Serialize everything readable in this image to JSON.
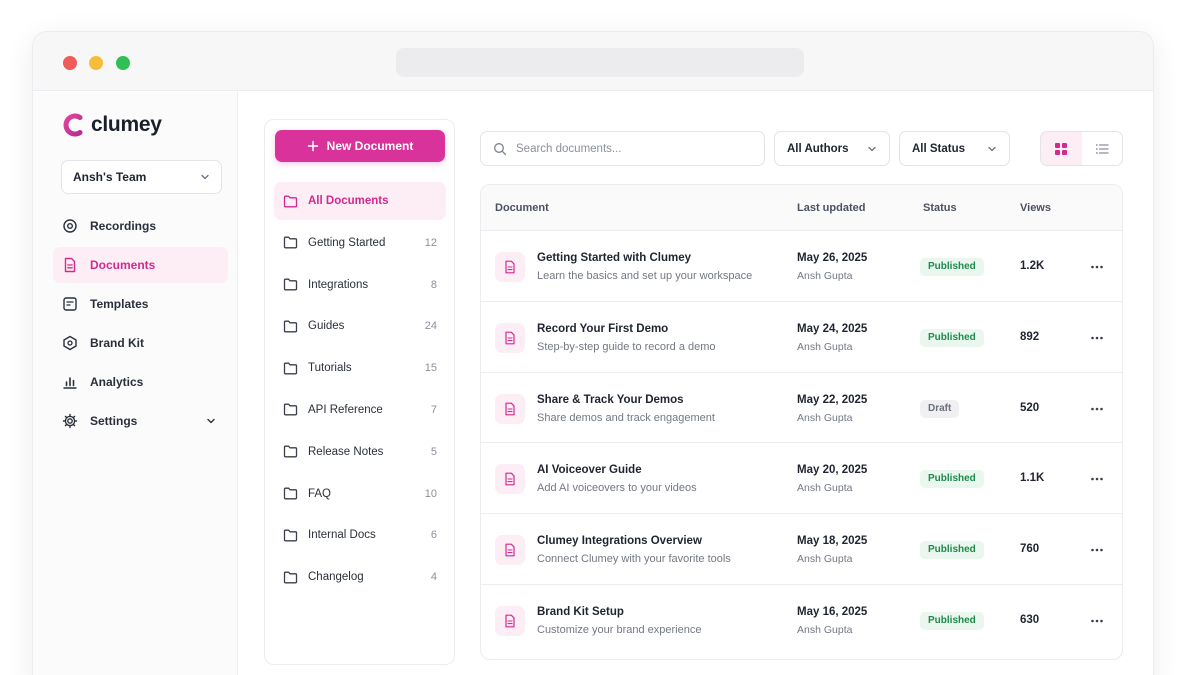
{
  "brand": {
    "name": "clumey",
    "accent": "#d9339b"
  },
  "sidebar": {
    "team": "Ansh's Team",
    "items": [
      {
        "label": "Recordings",
        "icon": "record-icon"
      },
      {
        "label": "Documents",
        "icon": "document-icon",
        "active": true
      },
      {
        "label": "Templates",
        "icon": "template-icon"
      },
      {
        "label": "Brand Kit",
        "icon": "brand-kit-icon"
      },
      {
        "label": "Analytics",
        "icon": "analytics-icon"
      },
      {
        "label": "Settings",
        "icon": "gear-icon"
      }
    ]
  },
  "folders": {
    "new_button": "New Document",
    "items": [
      {
        "label": "All Documents",
        "count": "",
        "active": true
      },
      {
        "label": "Getting Started",
        "count": "12"
      },
      {
        "label": "Integrations",
        "count": "8"
      },
      {
        "label": "Guides",
        "count": "24"
      },
      {
        "label": "Tutorials",
        "count": "15"
      },
      {
        "label": "API Reference",
        "count": "7"
      },
      {
        "label": "Release Notes",
        "count": "5"
      },
      {
        "label": "FAQ",
        "count": "10"
      },
      {
        "label": "Internal Docs",
        "count": "6"
      },
      {
        "label": "Changelog",
        "count": "4"
      }
    ]
  },
  "toolbar": {
    "search_placeholder": "Search documents...",
    "authors_filter": "All Authors",
    "status_filter": "All Status",
    "view": "grid"
  },
  "table": {
    "columns": [
      "Document",
      "Last updated",
      "Status",
      "Views"
    ],
    "rows": [
      {
        "title": "Getting Started with Clumey",
        "subtitle": "Learn the basics and set up your workspace",
        "date": "May 26, 2025",
        "author": "Ansh Gupta",
        "status": "Published",
        "views": "1.2K"
      },
      {
        "title": "Record Your First Demo",
        "subtitle": "Step-by-step guide to record a demo",
        "date": "May 24, 2025",
        "author": "Ansh Gupta",
        "status": "Published",
        "views": "892"
      },
      {
        "title": "Share & Track Your Demos",
        "subtitle": "Share demos and track engagement",
        "date": "May 22, 2025",
        "author": "Ansh Gupta",
        "status": "Draft",
        "views": "520"
      },
      {
        "title": "AI Voiceover Guide",
        "subtitle": "Add AI voiceovers to your videos",
        "date": "May 20, 2025",
        "author": "Ansh Gupta",
        "status": "Published",
        "views": "1.1K"
      },
      {
        "title": "Clumey Integrations Overview",
        "subtitle": "Connect Clumey with your favorite tools",
        "date": "May 18, 2025",
        "author": "Ansh Gupta",
        "status": "Published",
        "views": "760"
      },
      {
        "title": "Brand Kit Setup",
        "subtitle": "Customize your brand experience",
        "date": "May 16, 2025",
        "author": "Ansh Gupta",
        "status": "Published",
        "views": "630"
      }
    ]
  }
}
